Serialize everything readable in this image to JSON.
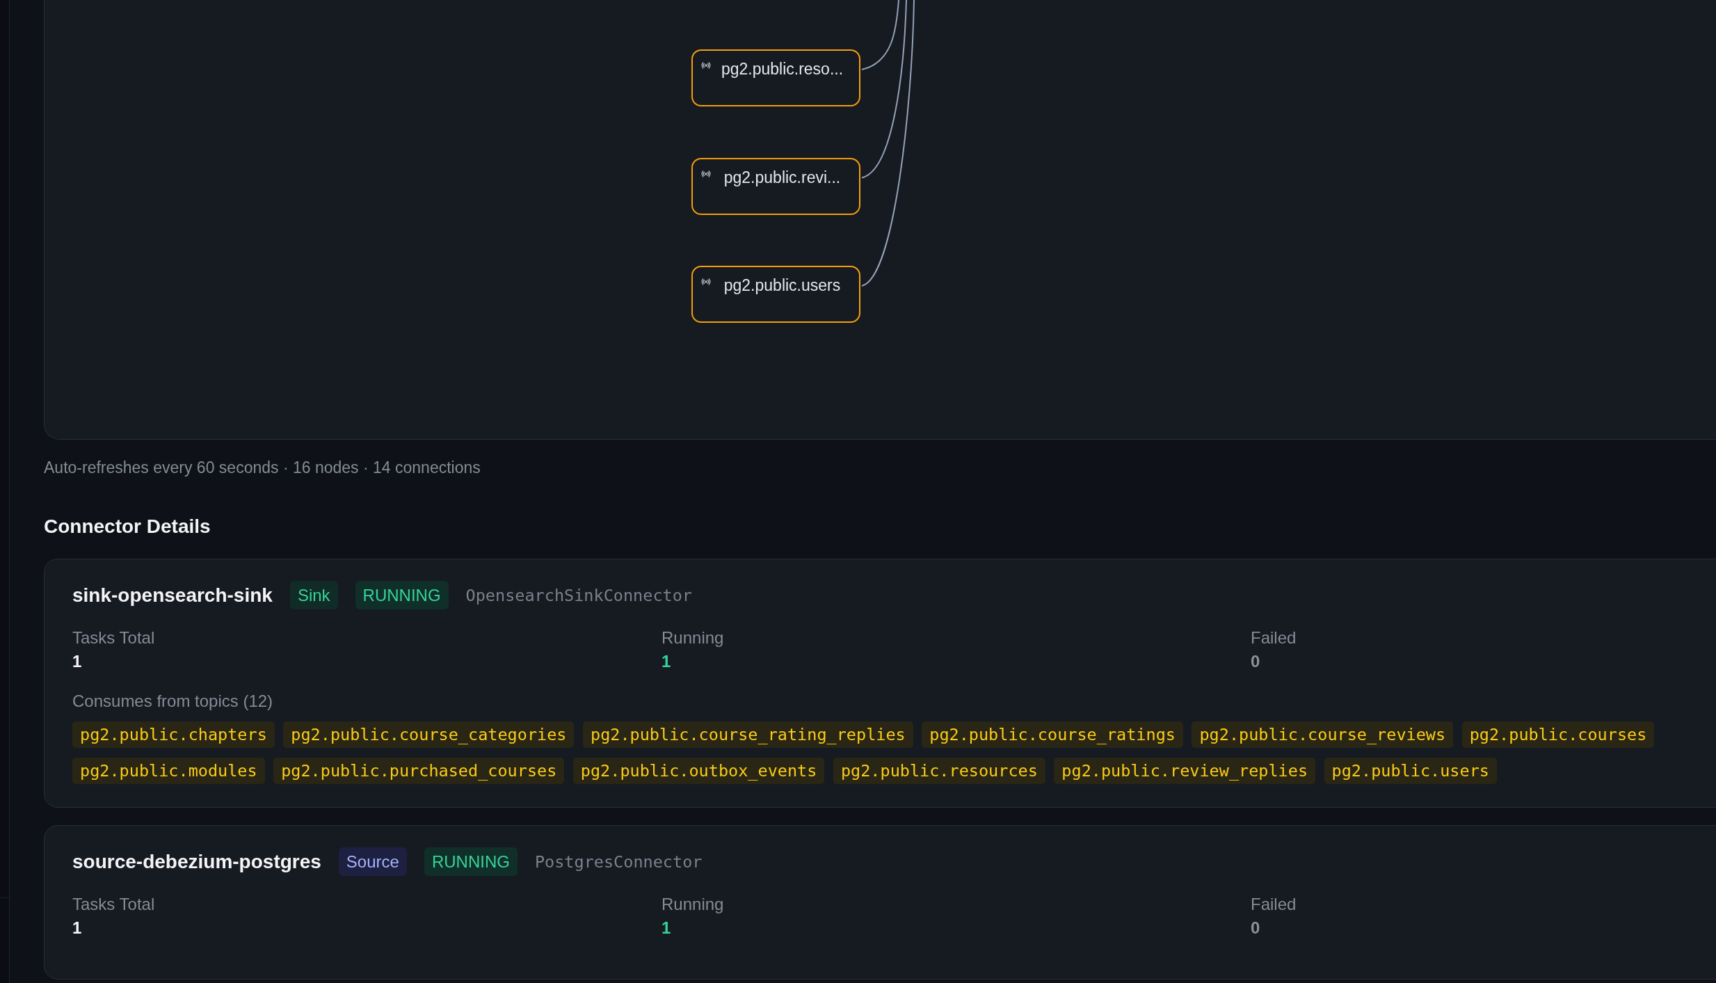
{
  "flow_graph": {
    "nodes": [
      {
        "label": "pg2.public.reso...",
        "kind": "topic"
      },
      {
        "label": "pg2.public.revi...",
        "kind": "topic"
      },
      {
        "label": "pg2.public.users",
        "kind": "topic"
      }
    ],
    "status_text": "Auto-refreshes every 60 seconds · 16 nodes · 14 connections"
  },
  "connector_details": {
    "title": "Connector Details",
    "connectors": [
      {
        "name": "sink-opensearch-sink",
        "type": {
          "label": "Sink",
          "kind": "sink"
        },
        "status": {
          "label": "RUNNING",
          "kind": "running"
        },
        "class_name": "OpensearchSinkConnector",
        "stats": [
          {
            "label": "Tasks Total",
            "value": "1",
            "kind": "total"
          },
          {
            "label": "Running",
            "value": "1",
            "kind": "running"
          },
          {
            "label": "Failed",
            "value": "0",
            "kind": "failed"
          }
        ],
        "topics": {
          "label": "Consumes from topics (12)",
          "items": [
            "pg2.public.chapters",
            "pg2.public.course_categories",
            "pg2.public.course_rating_replies",
            "pg2.public.course_ratings",
            "pg2.public.course_reviews",
            "pg2.public.courses",
            "pg2.public.modules",
            "pg2.public.purchased_courses",
            "pg2.public.outbox_events",
            "pg2.public.resources",
            "pg2.public.review_replies",
            "pg2.public.users"
          ]
        }
      },
      {
        "name": "source-debezium-postgres",
        "type": {
          "label": "Source",
          "kind": "source"
        },
        "status": {
          "label": "RUNNING",
          "kind": "running"
        },
        "class_name": "PostgresConnector",
        "stats": [
          {
            "label": "Tasks Total",
            "value": "1",
            "kind": "total"
          },
          {
            "label": "Running",
            "value": "1",
            "kind": "running"
          },
          {
            "label": "Failed",
            "value": "0",
            "kind": "failed"
          }
        ]
      }
    ]
  }
}
